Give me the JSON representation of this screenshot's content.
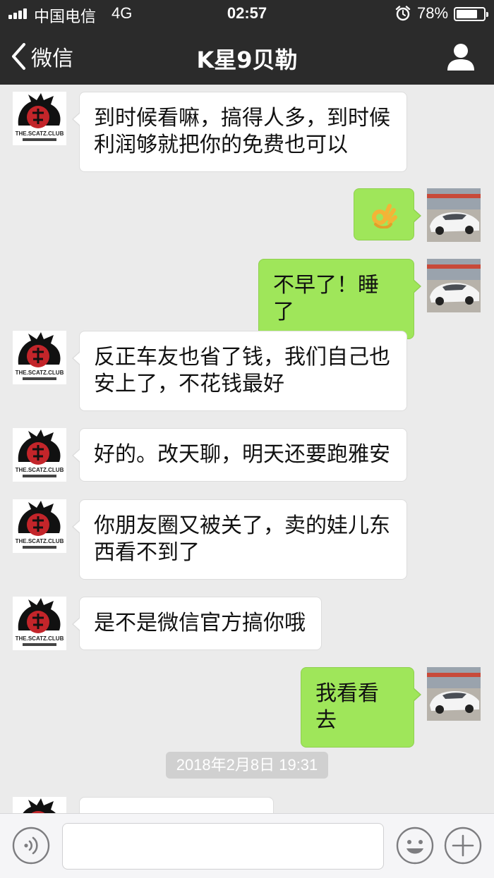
{
  "status_bar": {
    "carrier": "中国电信",
    "network": "4G",
    "time": "02:57",
    "battery_percent": "78%",
    "battery_level": 0.78,
    "icons": [
      "signal-icon",
      "alarm-icon",
      "battery-icon"
    ]
  },
  "nav": {
    "back_label": "微信",
    "title": "K星9贝勒",
    "icons": [
      "back-chevron-icon",
      "profile-icon"
    ]
  },
  "avatars": {
    "contact_text": "THE.SCATZ.CLUB"
  },
  "messages": [
    {
      "side": "in",
      "text": "到时候看嘛，搞得人多，到时候\n利润够就把你的免费也可以"
    },
    {
      "side": "out",
      "emoji": "ok-hand-emoji",
      "text": "👌"
    },
    {
      "side": "out",
      "text": "不早了！睡了"
    },
    {
      "side": "in",
      "text": "反正车友也省了钱，我们自己也\n安上了，不花钱最好"
    },
    {
      "side": "in",
      "text": "好的。改天聊，明天还要跑雅安"
    },
    {
      "side": "in",
      "text": "你朋友圈又被关了，卖的娃儿东\n西看不到了"
    },
    {
      "side": "in",
      "text": "是不是微信官方搞你哦"
    },
    {
      "side": "out",
      "text": "我看看去"
    }
  ],
  "timestamp": "2018年2月8日 19:31",
  "input_bar": {
    "value": "",
    "icons": [
      "voice-icon",
      "emoji-icon",
      "plus-icon"
    ]
  },
  "colors": {
    "header_bg": "#2b2b2b",
    "chat_bg": "#ebebeb",
    "out_bubble": "#9fe65a",
    "in_bubble": "#ffffff"
  }
}
